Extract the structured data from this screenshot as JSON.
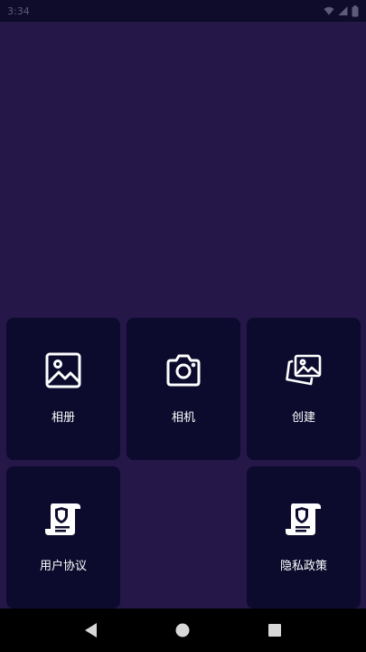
{
  "status_bar": {
    "time": "3:34",
    "icons": [
      "wifi-icon",
      "signal-icon",
      "battery-icon"
    ]
  },
  "tiles": [
    {
      "label": "相册",
      "icon": "image-icon"
    },
    {
      "label": "相机",
      "icon": "camera-icon"
    },
    {
      "label": "创建",
      "icon": "images-stack-icon"
    },
    {
      "label": "用户协议",
      "icon": "document-shield-icon"
    },
    {
      "label": "隐私政策",
      "icon": "document-shield-icon"
    }
  ],
  "nav_bar": {
    "buttons": [
      "back-icon",
      "home-icon",
      "recents-icon"
    ]
  },
  "colors": {
    "background": "#251747",
    "card": "#0c0b2e",
    "status_bar": "#0f0b2b",
    "nav_bar": "#000000",
    "text": "#ffffff"
  }
}
